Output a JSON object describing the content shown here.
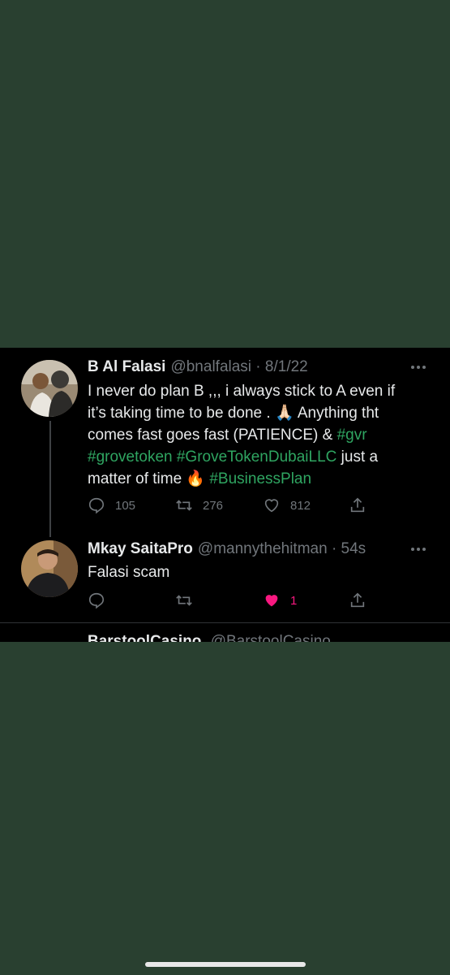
{
  "tweet1": {
    "name": "B Al Falasi",
    "meta": "@bnalfalasi · 8/1/22",
    "line1": "I never do plan B ,,, i always stick to A even if",
    "line2": "it’s taking time to be done . 🙏🏻 Anything tht",
    "line3a": "comes fast goes fast (PATIENCE) & ",
    "line3tag": "#gvr",
    "line4tag1": "#grovetoken",
    "line4tag2": "#GroveTokenDubaiLLC",
    "line4rest": " just a",
    "line5a": "matter of time 🔥 ",
    "line5tag": "#BusinessPlan",
    "replies": "105",
    "retweets": "276",
    "likes": "812",
    "icons": [
      "reply-icon",
      "retweet-icon",
      "like-icon",
      "share-icon",
      "more-icon"
    ]
  },
  "tweet2": {
    "name": "Mkay SaitaPro",
    "meta": "@mannythehitman · 54s",
    "text": "Falasi scam",
    "likes": "1",
    "liked": true,
    "like_color": "#f91880"
  },
  "tweet3_peek": {
    "name": "BarstoolCasino",
    "meta": "@BarstoolCasino"
  },
  "colors": {
    "background": "#294030",
    "hashtag": "#2fa561",
    "muted": "#71767b"
  }
}
